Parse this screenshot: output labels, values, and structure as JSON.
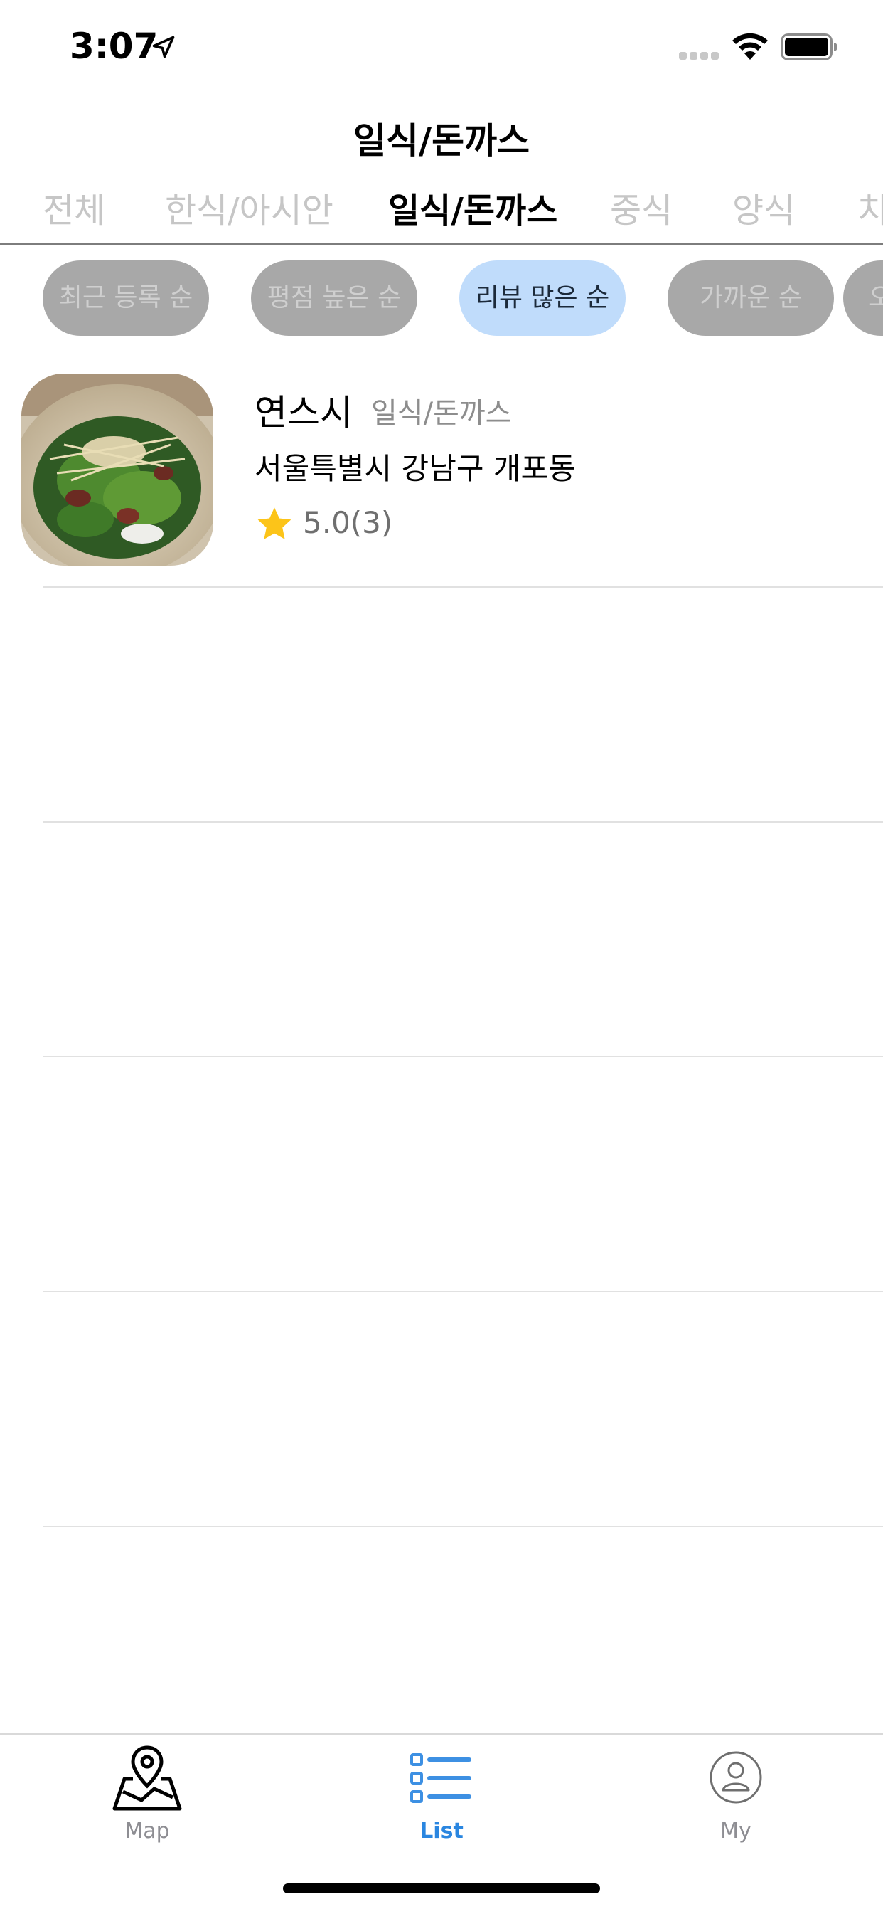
{
  "status_bar": {
    "time": "3:07"
  },
  "header": {
    "title": "일식/돈까스"
  },
  "category_tabs": [
    {
      "label": "전체",
      "active": false
    },
    {
      "label": "한식/아시안",
      "active": false
    },
    {
      "label": "일식/돈까스",
      "active": true
    },
    {
      "label": "중식",
      "active": false
    },
    {
      "label": "양식",
      "active": false
    },
    {
      "label": "치",
      "active": false
    }
  ],
  "sort_chips": [
    {
      "label": "최근 등록 순",
      "active": false
    },
    {
      "label": "평점 높은 순",
      "active": false
    },
    {
      "label": "리뷰 많은 순",
      "active": true
    },
    {
      "label": "가까운 순",
      "active": false
    },
    {
      "label": "오",
      "active": false
    }
  ],
  "restaurants": [
    {
      "name": "연스시",
      "category": "일식/돈까스",
      "address": "서울특별시 강남구 개포동",
      "rating": "5.0(3)",
      "thumbnail": "salad-food-photo"
    }
  ],
  "tab_bar": {
    "items": [
      {
        "label": "Map",
        "icon": "map-pin-icon",
        "active": false
      },
      {
        "label": "List",
        "icon": "list-icon",
        "active": true
      },
      {
        "label": "My",
        "icon": "user-circle-icon",
        "active": false
      }
    ]
  },
  "colors": {
    "accent": "#2a86e0",
    "chip_active_bg": "#c0dcfb",
    "chip_inactive_bg": "#a8a8a8",
    "star": "#fcc419"
  }
}
